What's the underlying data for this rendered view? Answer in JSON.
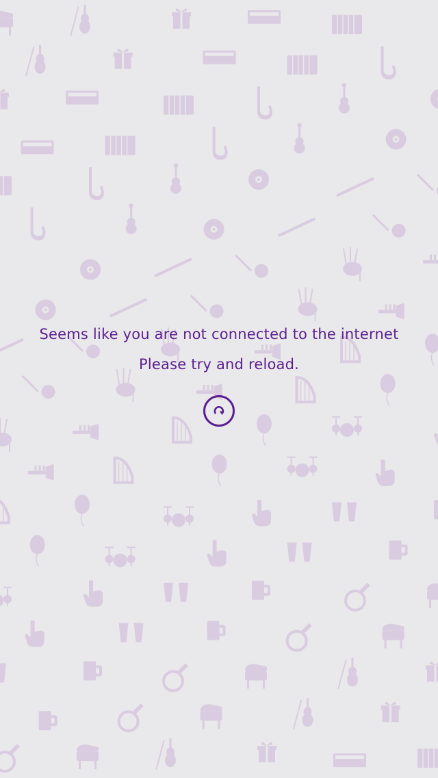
{
  "screen": {
    "background_color": "#e9e8ea",
    "pattern_color": "#d9cce0",
    "accent_color": "#5b1f8f"
  },
  "offline_notice": {
    "line1": "Seems like you are not connected to the internet",
    "line2": "Please try and reload."
  },
  "reload": {
    "icon": "reload-icon"
  },
  "background_pattern": {
    "icons": [
      "piano-icon",
      "trumpet-icon",
      "keyboard-icon",
      "drum-kit-icon",
      "guitar-icon",
      "beer-mug-icon",
      "banjo-icon",
      "violin-icon",
      "harp-icon",
      "accordion-icon",
      "hand-icon",
      "vinyl-record-icon",
      "french-horn-icon",
      "bagpipes-icon",
      "gift-icon",
      "balloon-icon",
      "saxophone-icon",
      "bongos-icon",
      "flute-icon"
    ]
  }
}
